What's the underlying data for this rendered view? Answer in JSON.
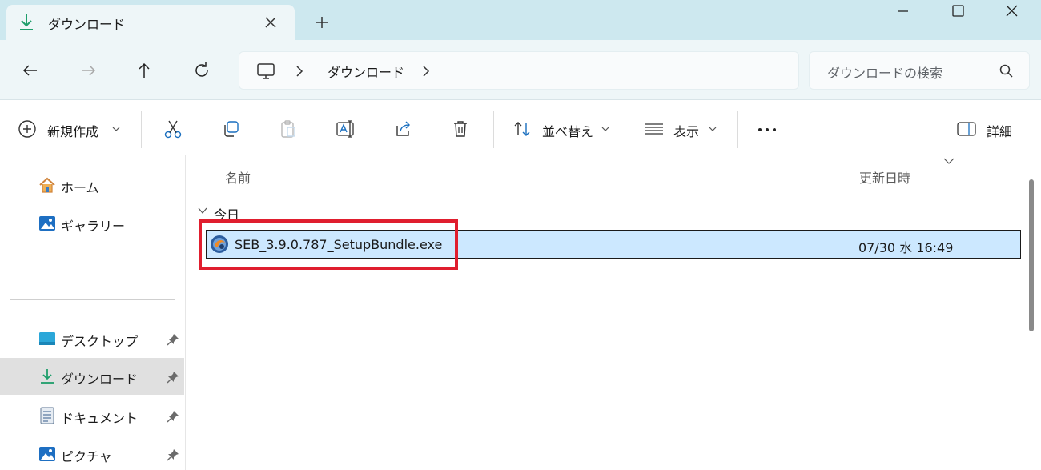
{
  "window": {
    "tab_title": "ダウンロード",
    "accent_color": "#1e9e6b"
  },
  "address": {
    "crumb": "ダウンロード",
    "search_placeholder": "ダウンロードの検索"
  },
  "toolbar": {
    "new_label": "新規作成",
    "sort_label": "並べ替え",
    "view_label": "表示",
    "details_label": "詳細"
  },
  "sidebar": {
    "items": [
      {
        "label": "ホーム",
        "icon": "home-icon"
      },
      {
        "label": "ギャラリー",
        "icon": "gallery-icon"
      },
      {
        "label": "デスクトップ",
        "icon": "desktop-folder-icon",
        "pinned": true
      },
      {
        "label": "ダウンロード",
        "icon": "download-icon",
        "pinned": true,
        "active": true
      },
      {
        "label": "ドキュメント",
        "icon": "document-icon",
        "pinned": true
      },
      {
        "label": "ピクチャ",
        "icon": "pictures-icon",
        "pinned": true
      }
    ]
  },
  "content": {
    "columns": {
      "name": "名前",
      "date": "更新日時"
    },
    "group_label": "今日",
    "files": [
      {
        "name": "SEB_3.9.0.787_SetupBundle.exe",
        "date": "07/30 水 16:49",
        "selected": true
      }
    ],
    "highlight_color": "#e01e2e"
  }
}
